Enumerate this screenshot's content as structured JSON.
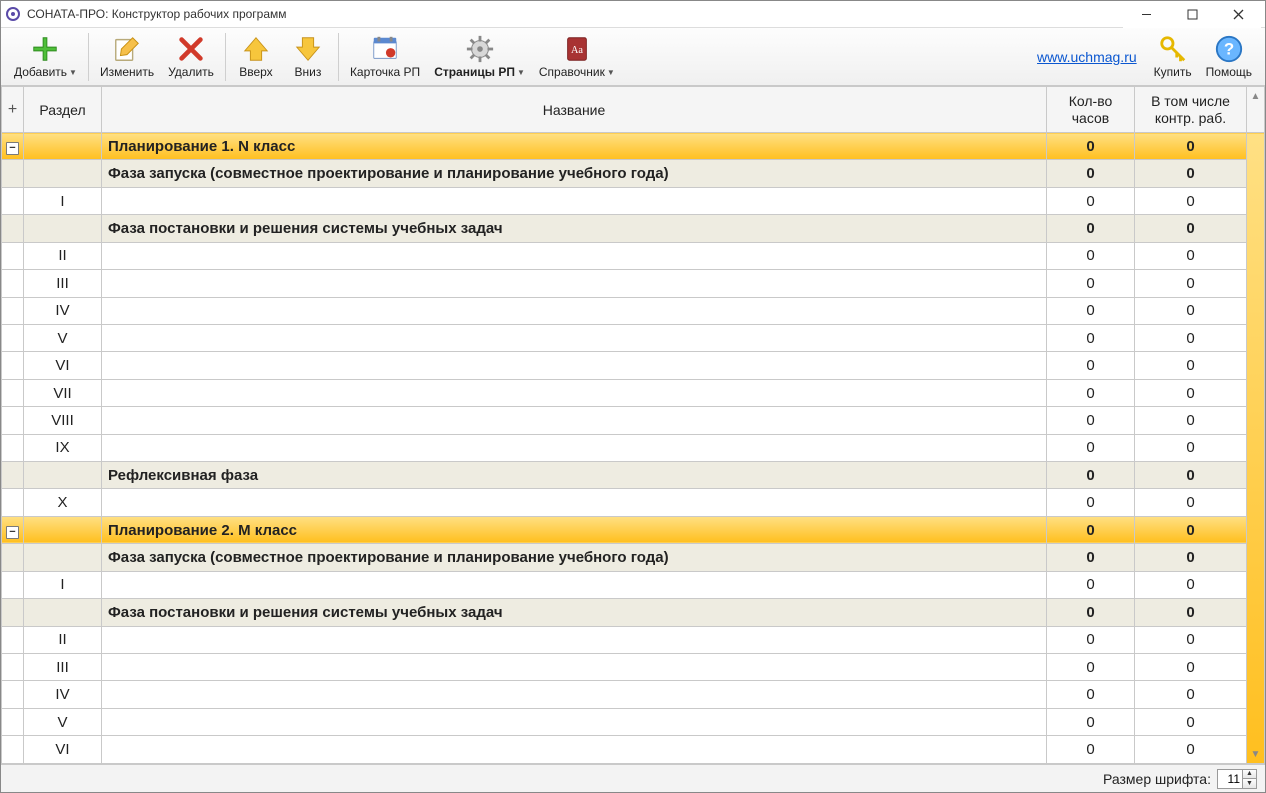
{
  "window": {
    "title": "СОНАТА-ПРО: Конструктор рабочих программ"
  },
  "toolbar": {
    "add": "Добавить",
    "edit": "Изменить",
    "delete": "Удалить",
    "up": "Вверх",
    "down": "Вниз",
    "card": "Карточка РП",
    "pages": "Страницы РП",
    "reference": "Справочник",
    "link": "www.uchmag.ru",
    "buy": "Купить",
    "help": "Помощь"
  },
  "headers": {
    "plus": "+",
    "section": "Раздел",
    "name": "Название",
    "hours": "Кол-во часов",
    "kontr": "В том числе контр. раб."
  },
  "rows": [
    {
      "level": 0,
      "toggle": "−",
      "section": "",
      "name": "Планирование 1. N класс",
      "hours": "0",
      "kontr": "0"
    },
    {
      "level": 1,
      "section": "",
      "name": "Фаза запуска (совместное проектирование и  планирование учебного года)",
      "hours": "0",
      "kontr": "0"
    },
    {
      "level": 2,
      "section": "I",
      "name": "",
      "hours": "0",
      "kontr": "0"
    },
    {
      "level": 1,
      "section": "",
      "name": "Фаза постановки и решения системы учебных задач",
      "hours": "0",
      "kontr": "0"
    },
    {
      "level": 2,
      "section": "II",
      "name": "",
      "hours": "0",
      "kontr": "0"
    },
    {
      "level": 2,
      "section": "III",
      "name": "",
      "hours": "0",
      "kontr": "0"
    },
    {
      "level": 2,
      "section": "IV",
      "name": "",
      "hours": "0",
      "kontr": "0"
    },
    {
      "level": 2,
      "section": "V",
      "name": "",
      "hours": "0",
      "kontr": "0"
    },
    {
      "level": 2,
      "section": "VI",
      "name": "",
      "hours": "0",
      "kontr": "0"
    },
    {
      "level": 2,
      "section": "VII",
      "name": "",
      "hours": "0",
      "kontr": "0"
    },
    {
      "level": 2,
      "section": "VIII",
      "name": "",
      "hours": "0",
      "kontr": "0"
    },
    {
      "level": 2,
      "section": "IX",
      "name": "",
      "hours": "0",
      "kontr": "0"
    },
    {
      "level": 1,
      "section": "",
      "name": "Рефлексивная фаза",
      "hours": "0",
      "kontr": "0"
    },
    {
      "level": 2,
      "section": "X",
      "name": "",
      "hours": "0",
      "kontr": "0"
    },
    {
      "level": 0,
      "toggle": "−",
      "section": "",
      "name": "Планирование 2. М класс",
      "hours": "0",
      "kontr": "0"
    },
    {
      "level": 1,
      "section": "",
      "name": "Фаза запуска (совместное проектирование и  планирование учебного года)",
      "hours": "0",
      "kontr": "0"
    },
    {
      "level": 2,
      "section": "I",
      "name": "",
      "hours": "0",
      "kontr": "0"
    },
    {
      "level": 1,
      "section": "",
      "name": "Фаза постановки и решения системы учебных задач",
      "hours": "0",
      "kontr": "0"
    },
    {
      "level": 2,
      "section": "II",
      "name": "",
      "hours": "0",
      "kontr": "0"
    },
    {
      "level": 2,
      "section": "III",
      "name": "",
      "hours": "0",
      "kontr": "0"
    },
    {
      "level": 2,
      "section": "IV",
      "name": "",
      "hours": "0",
      "kontr": "0"
    },
    {
      "level": 2,
      "section": "V",
      "name": "",
      "hours": "0",
      "kontr": "0"
    },
    {
      "level": 2,
      "section": "VI",
      "name": "",
      "hours": "0",
      "kontr": "0"
    }
  ],
  "status": {
    "font_size_label": "Размер шрифта:",
    "font_size_value": "11"
  }
}
